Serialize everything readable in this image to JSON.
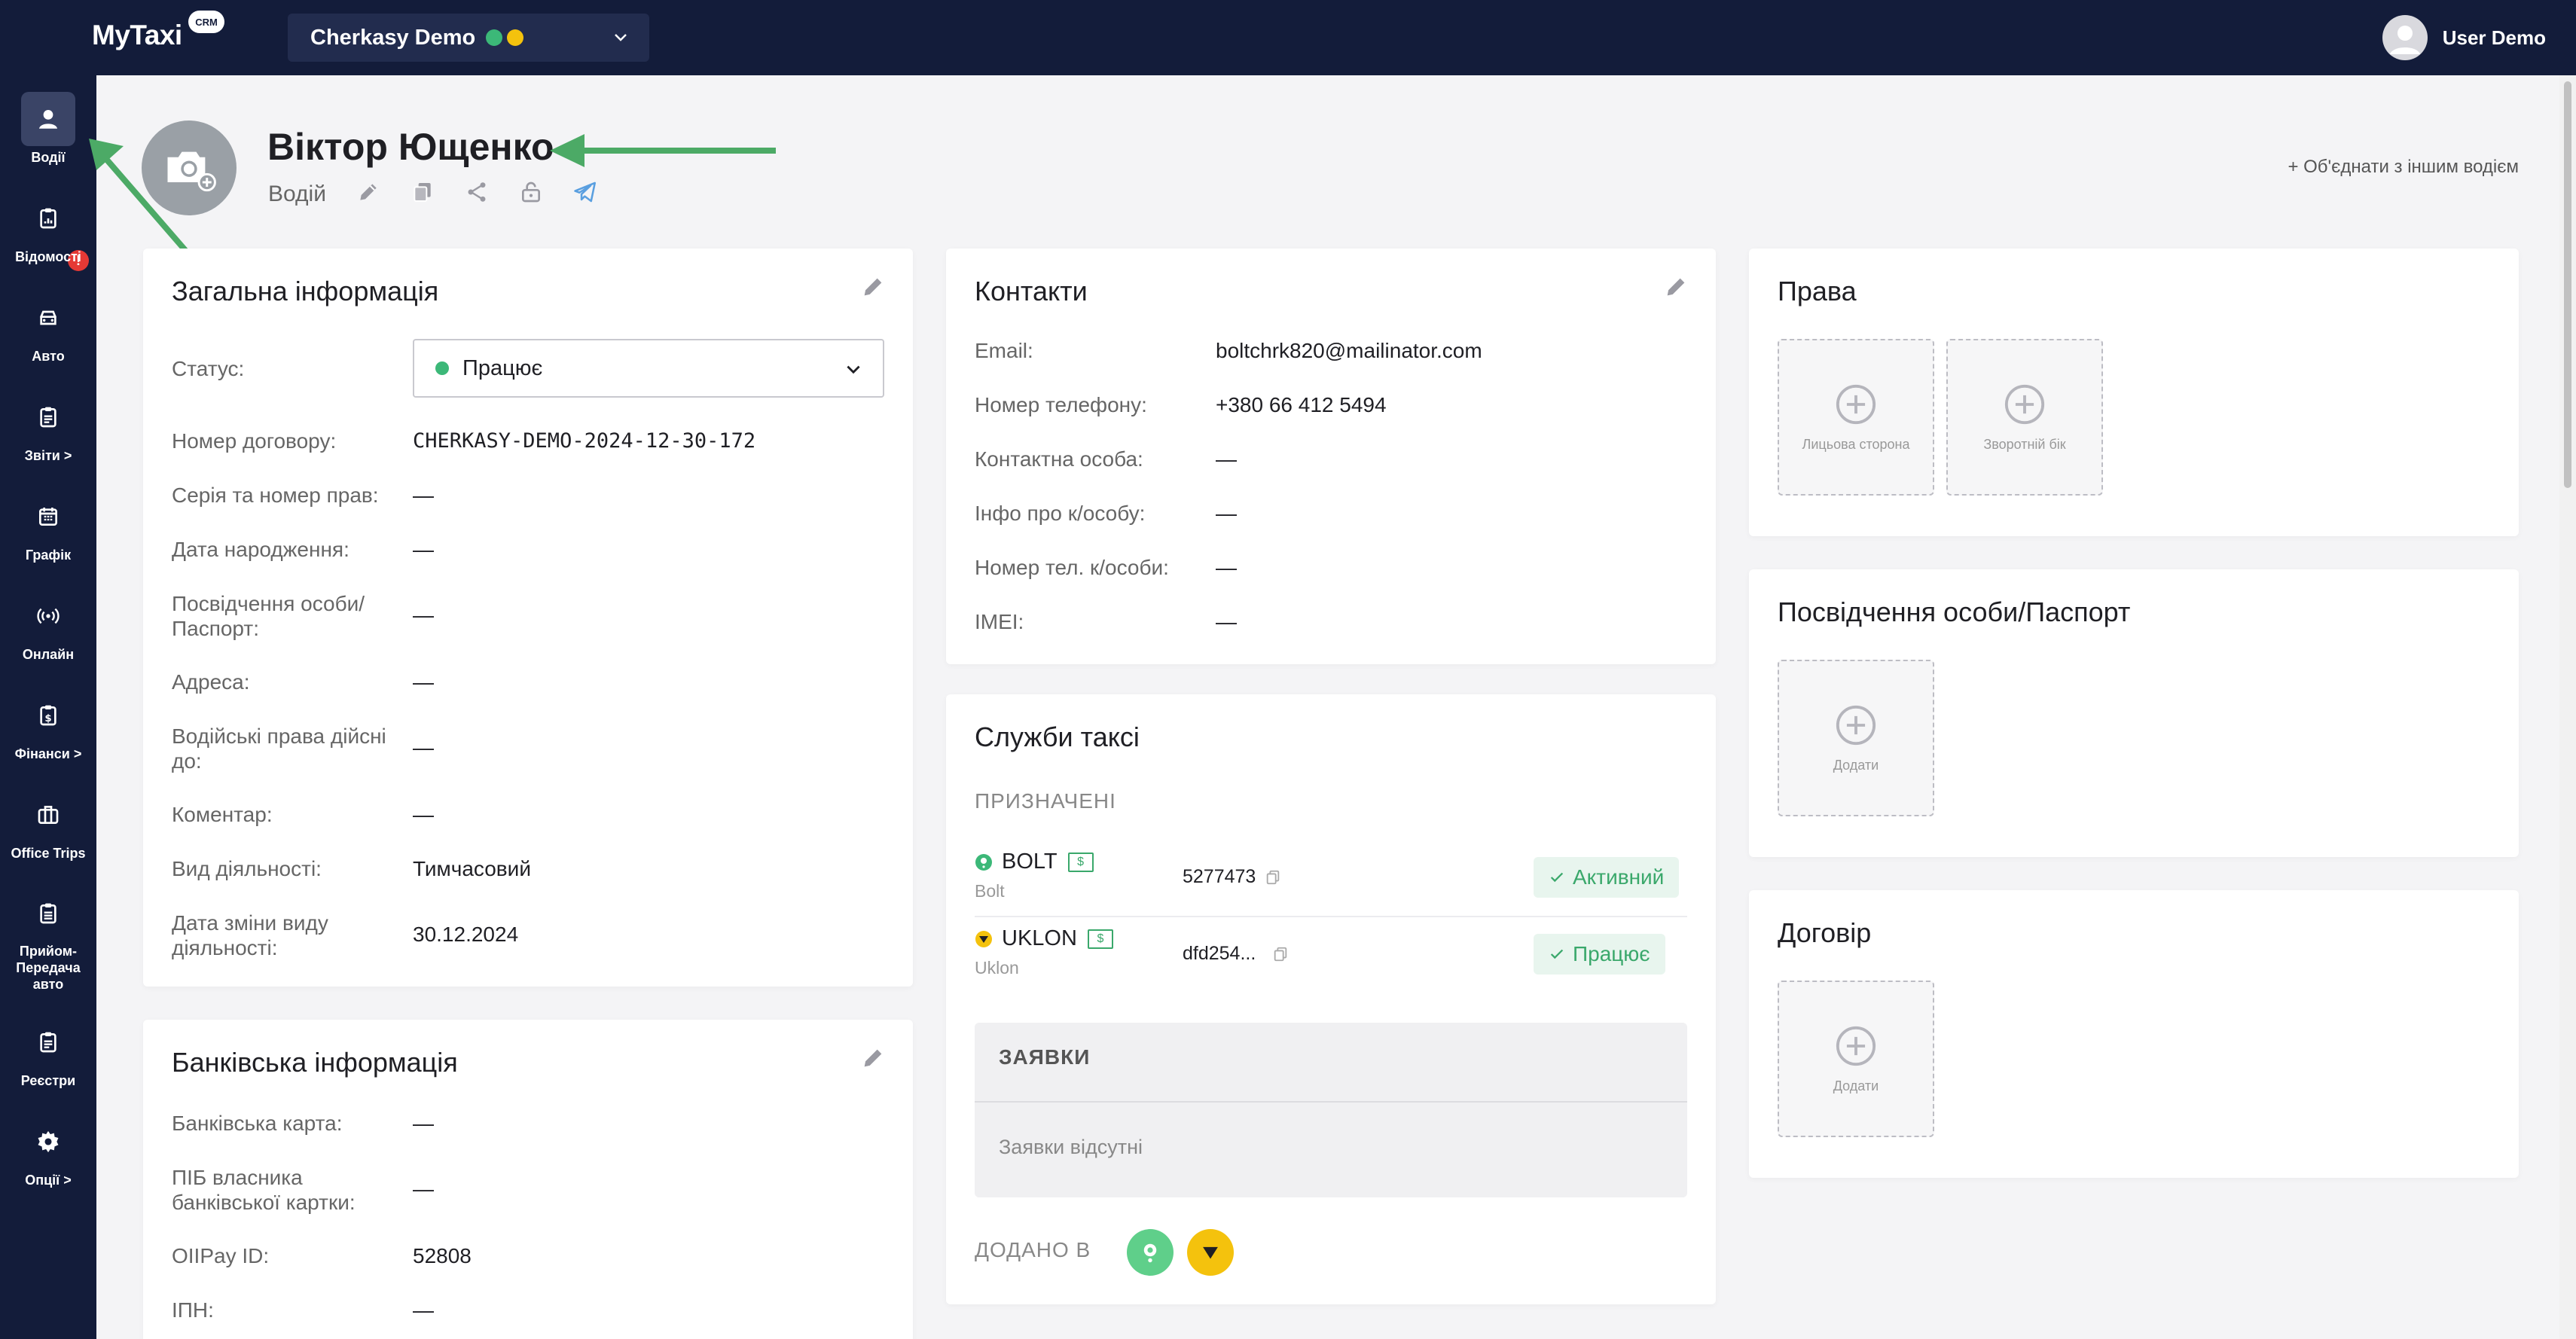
{
  "app": {
    "brand": "MyTaxi",
    "brand_badge": "CRM",
    "company": "Cherkasy Demo",
    "company_dots": [
      "#3cb878",
      "#f4c20d"
    ],
    "user": "User Demo"
  },
  "sidebar": {
    "items": [
      {
        "label": "Водії",
        "icon": "user-icon",
        "active": true
      },
      {
        "label": "Відомості",
        "icon": "clipboard-icon"
      },
      {
        "label": "Авто",
        "icon": "car-icon"
      },
      {
        "label": "Звіти >",
        "icon": "report-icon"
      },
      {
        "label": "Графік",
        "icon": "calendar-icon"
      },
      {
        "label": "Онлайн",
        "icon": "broadcast-icon"
      },
      {
        "label": "Фінанси >",
        "icon": "dollar-icon"
      },
      {
        "label": "Office Trips",
        "icon": "briefcase-icon"
      },
      {
        "label": "Прийом-Передача авто",
        "icon": "clipboard-list-icon"
      },
      {
        "label": "Реєстри",
        "icon": "registry-icon"
      },
      {
        "label": "Опції >",
        "icon": "gear-icon"
      }
    ],
    "alert": "!"
  },
  "driver": {
    "name": "Віктор Ющенко",
    "role": "Водій",
    "merge_link": "+ Об'єднати з іншим водієм"
  },
  "general_info": {
    "title": "Загальна інформація",
    "status_label": "Статус:",
    "status_value": "Працює",
    "rows": [
      {
        "label": "Номер договору:",
        "value": "CHERKASY-DEMO-2024-12-30-172"
      },
      {
        "label": "Серія та номер прав:",
        "value": "—"
      },
      {
        "label": "Дата народження:",
        "value": "—"
      },
      {
        "label": "Посвідчення особи/ Паспорт:",
        "value": "—"
      },
      {
        "label": "Адреса:",
        "value": "—"
      },
      {
        "label": "Водійські права дійсні до:",
        "value": "—"
      },
      {
        "label": "Коментар:",
        "value": "—"
      },
      {
        "label": "Вид діяльності:",
        "value": "Тимчасовий"
      },
      {
        "label": "Дата зміни виду діяльності:",
        "value": "30.12.2024"
      }
    ]
  },
  "bank_info": {
    "title": "Банківська інформація",
    "rows": [
      {
        "label": "Банківська карта:",
        "value": "—"
      },
      {
        "label": "ПІБ власника банківської картки:",
        "value": "—"
      },
      {
        "label": "OIIPay ID:",
        "value": "52808"
      },
      {
        "label": "ІПН:",
        "value": "—"
      }
    ]
  },
  "contacts": {
    "title": "Контакти",
    "rows": [
      {
        "label": "Email:",
        "value": "boltchrk820@mailinator.com"
      },
      {
        "label": "Номер телефону:",
        "value": "+380 66 412 5494"
      },
      {
        "label": "Контактна особа:",
        "value": "—"
      },
      {
        "label": "Інфо про к/особу:",
        "value": "—"
      },
      {
        "label": "Номер тел. к/особи:",
        "value": "—"
      },
      {
        "label": "IMEI:",
        "value": "—"
      }
    ]
  },
  "taxi_services": {
    "title": "Служби таксі",
    "assigned_label": "ПРИЗНАЧЕНІ",
    "money_tag": "$",
    "services": [
      {
        "name": "BOLT",
        "sub": "Bolt",
        "code": "5277473",
        "status": "Активний",
        "color": "#3cb878"
      },
      {
        "name": "UKLON",
        "sub": "Uklon",
        "code": "dfd254...",
        "status": "Працює",
        "color": "#f4c20d"
      }
    ],
    "requests_title": "ЗАЯВКИ",
    "requests_empty": "Заявки відсутні",
    "added_label": "ДОДАНО В"
  },
  "rights": {
    "title": "Права",
    "front": "Лицьова сторона",
    "back": "Зворотній бік"
  },
  "passport": {
    "title": "Посвідчення особи/Паспорт",
    "add": "Додати"
  },
  "contract": {
    "title": "Договір",
    "add": "Додати"
  }
}
